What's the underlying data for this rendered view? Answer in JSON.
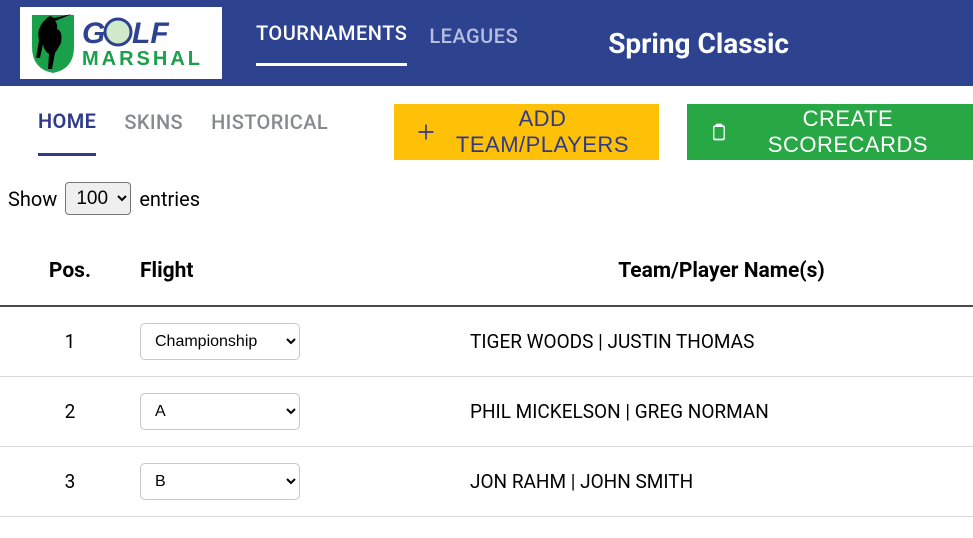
{
  "logo": {
    "top": "GOLF",
    "bottom": "MARSHAL"
  },
  "nav": {
    "links": [
      {
        "label": "TOURNAMENTS",
        "active": true
      },
      {
        "label": "LEAGUES",
        "active": false
      }
    ],
    "tournament_title": "Spring Classic"
  },
  "tabs": [
    {
      "label": "HOME",
      "active": true
    },
    {
      "label": "SKINS",
      "active": false
    },
    {
      "label": "HISTORICAL",
      "active": false
    }
  ],
  "buttons": {
    "add_team": "ADD TEAM/PLAYERS",
    "create_scorecards": "CREATE SCORECARDS"
  },
  "entries": {
    "show_label": "Show",
    "entries_label": "entries",
    "selected": "100"
  },
  "table": {
    "headers": {
      "pos": "Pos.",
      "flight": "Flight",
      "names": "Team/Player Name(s)"
    },
    "rows": [
      {
        "pos": "1",
        "flight": "Championship",
        "names": "TIGER WOODS | JUSTIN THOMAS"
      },
      {
        "pos": "2",
        "flight": "A",
        "names": "PHIL MICKELSON | GREG NORMAN"
      },
      {
        "pos": "3",
        "flight": "B",
        "names": "JON RAHM | JOHN SMITH"
      }
    ]
  }
}
